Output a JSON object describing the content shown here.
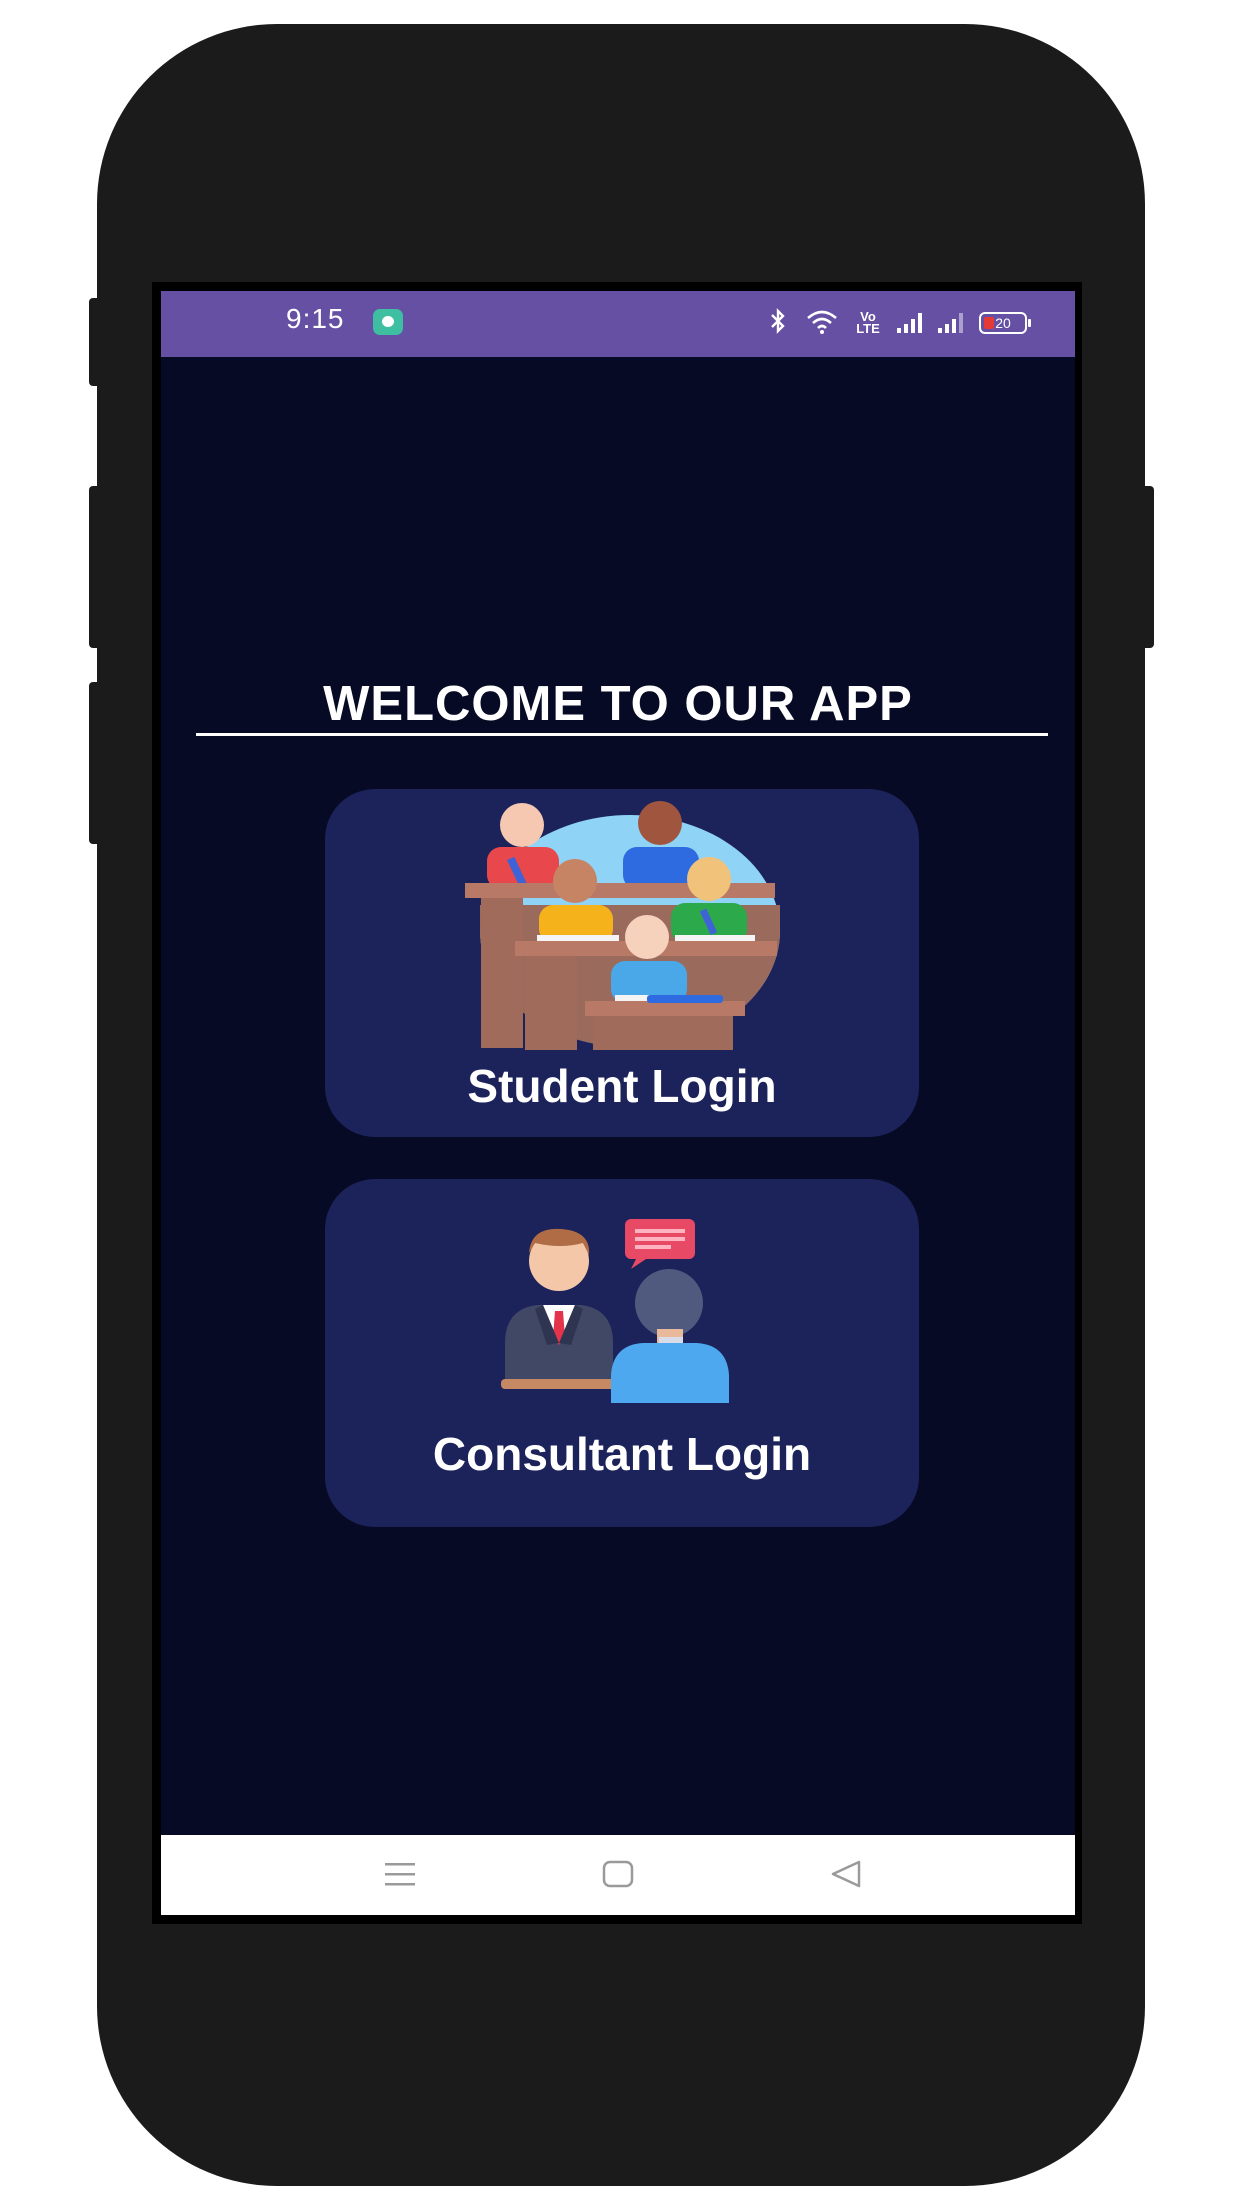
{
  "status_bar": {
    "time": "9:15",
    "notification_icon": "message-icon",
    "volte_label": "Vo LTE",
    "battery_level": "20",
    "icons": [
      "bluetooth-icon",
      "wifi-icon",
      "volte-icon",
      "signal-1-icon",
      "signal-2-icon",
      "battery-icon"
    ]
  },
  "main": {
    "title": "WELCOME TO OUR APP",
    "student_card": {
      "label": "Student Login",
      "icon": "classroom-students-icon"
    },
    "consultant_card": {
      "label": "Consultant Login",
      "icon": "consultant-meeting-icon"
    }
  },
  "nav_bar": {
    "buttons": [
      "menu-icon",
      "home-icon",
      "back-icon"
    ]
  },
  "colors": {
    "status_bar": "#6650a4",
    "background": "#070a24",
    "card": "#1c225a",
    "text": "#ffffff",
    "phone_body": "#1b1b1b"
  }
}
